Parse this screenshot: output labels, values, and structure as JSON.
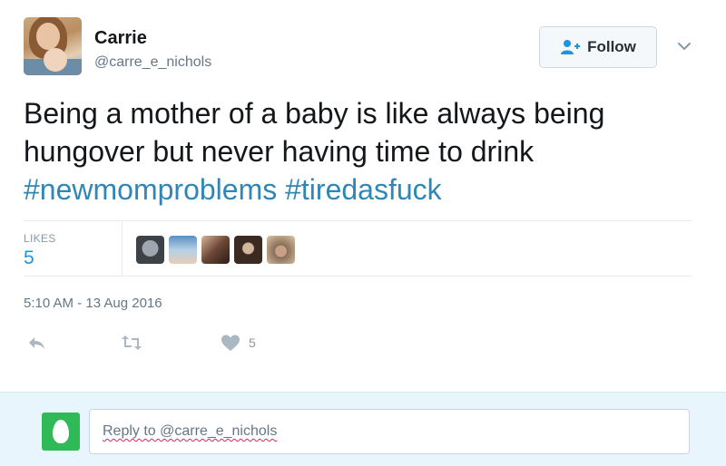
{
  "author": {
    "name": "Carrie",
    "handle": "@carre_e_nichols"
  },
  "follow_button": {
    "label": "Follow",
    "icon": "follow-user-icon"
  },
  "menu_icon": "chevron-down-icon",
  "tweet": {
    "text": "Being a mother of a baby is like always being hungover but never having time to drink",
    "hashtags": [
      "#newmomproblems",
      "#tiredasfuck"
    ]
  },
  "stats": {
    "likes_label": "LIKES",
    "likes_count": "5",
    "likers_count": 5
  },
  "timestamp": "5:10 AM - 13 Aug 2016",
  "actions": {
    "reply_icon": "reply-icon",
    "retweet_icon": "retweet-icon",
    "like_icon": "heart-icon",
    "like_count": "5"
  },
  "reply": {
    "placeholder": "Reply to @carre_e_nichols"
  },
  "colors": {
    "link": "#1b95e0",
    "muted": "#657786",
    "reply_bar_bg": "#e8f5fd",
    "egg_avatar": "#2fba57"
  }
}
